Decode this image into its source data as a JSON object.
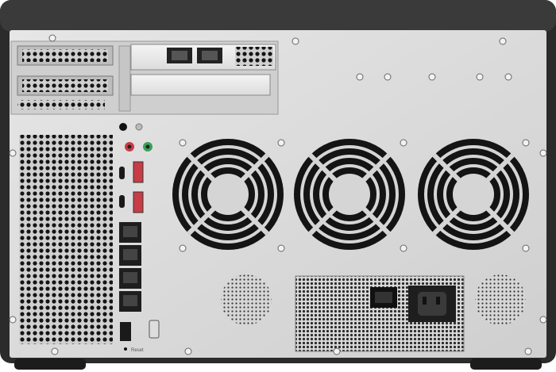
{
  "image": {
    "subject": "nas-rear-panel",
    "colors": {
      "chassis": "#2b2b2b",
      "panel": "#d9d9d9",
      "grille": "#141414",
      "accent_red": "#c83c46",
      "accent_green": "#3ca05a",
      "ethernet": "#1e1e1e"
    }
  },
  "labels": {
    "reset": "Reset"
  }
}
